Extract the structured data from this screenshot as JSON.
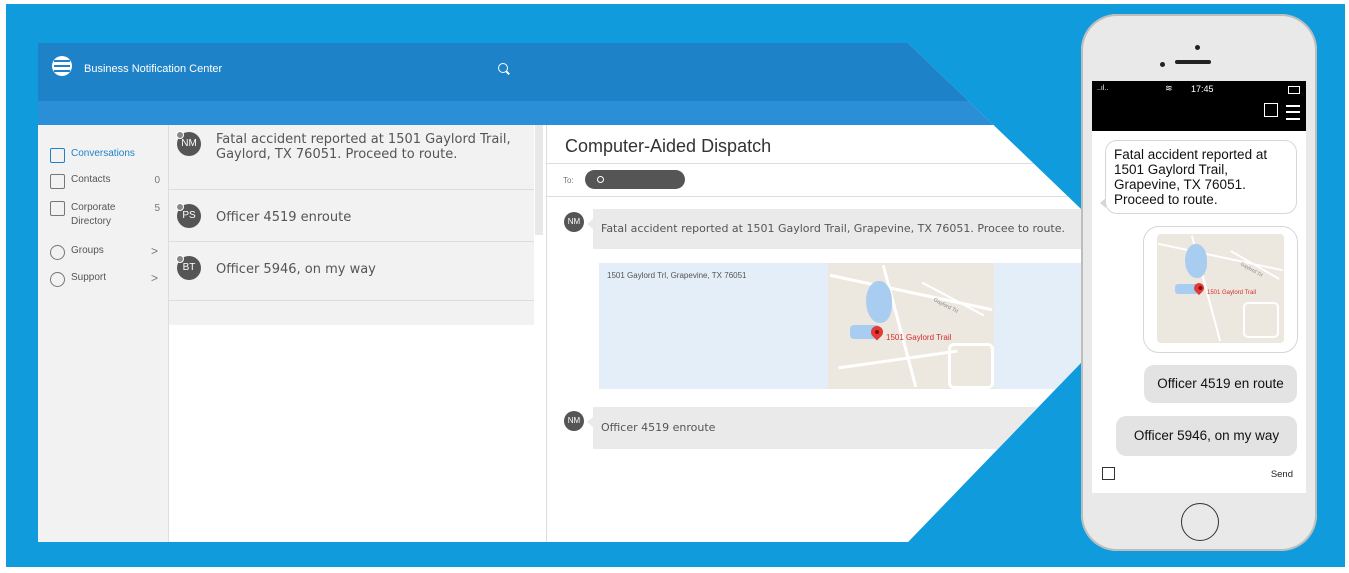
{
  "app": {
    "title": "Business Notification Center"
  },
  "sidebar": {
    "items": [
      {
        "label": "Conversations",
        "count": "",
        "chevron": "",
        "icon": "chat-icon"
      },
      {
        "label": "Contacts",
        "count": "0",
        "chevron": "",
        "icon": "contacts-icon"
      },
      {
        "label": "Corporate Directory",
        "count": "5",
        "chevron": "",
        "icon": "directory-icon"
      },
      {
        "label": "Groups",
        "count": "",
        "chevron": ">",
        "icon": "groups-icon"
      },
      {
        "label": "Support",
        "count": "",
        "chevron": ">",
        "icon": "help-icon"
      }
    ]
  },
  "conversations": [
    {
      "initials": "NM",
      "text": "Fatal accident reported at 1501 Gaylord Trail, Gaylord, TX 76051. Proceed to route."
    },
    {
      "initials": "PS",
      "text": "Officer 4519 enroute"
    },
    {
      "initials": "BT",
      "text": "Officer 5946, on my way"
    }
  ],
  "dispatch": {
    "title": "Computer-Aided Dispatch",
    "to_label": "To:",
    "messages": [
      {
        "initials": "NM",
        "text": "Fatal accident reported at 1501 Gaylord Trail, Grapevine, TX 76051. Procee to route."
      },
      {
        "initials": "NM",
        "text": "Officer 4519 enroute"
      }
    ],
    "map_address": "1501 Gaylord Trl, Grapevine, TX 76051",
    "map_label": "1501 Gaylord Trail",
    "map_road": "Gaylord Trl"
  },
  "phone": {
    "time": "17:45",
    "incoming": "Fatal accident reported at 1501 Gaylord Trail, Grapevine, TX 76051. Proceed to route.",
    "map_label": "1501 Gaylord Trail",
    "map_road": "Gaylord Trl",
    "outgoing": [
      "Officer 4519 en route",
      "Officer 5946, on my way"
    ],
    "send_label": "Send"
  },
  "colors": {
    "background": "#0f9bdc",
    "header": "#1e82c8",
    "accent": "#1e82c8",
    "pin": "#e53935"
  }
}
